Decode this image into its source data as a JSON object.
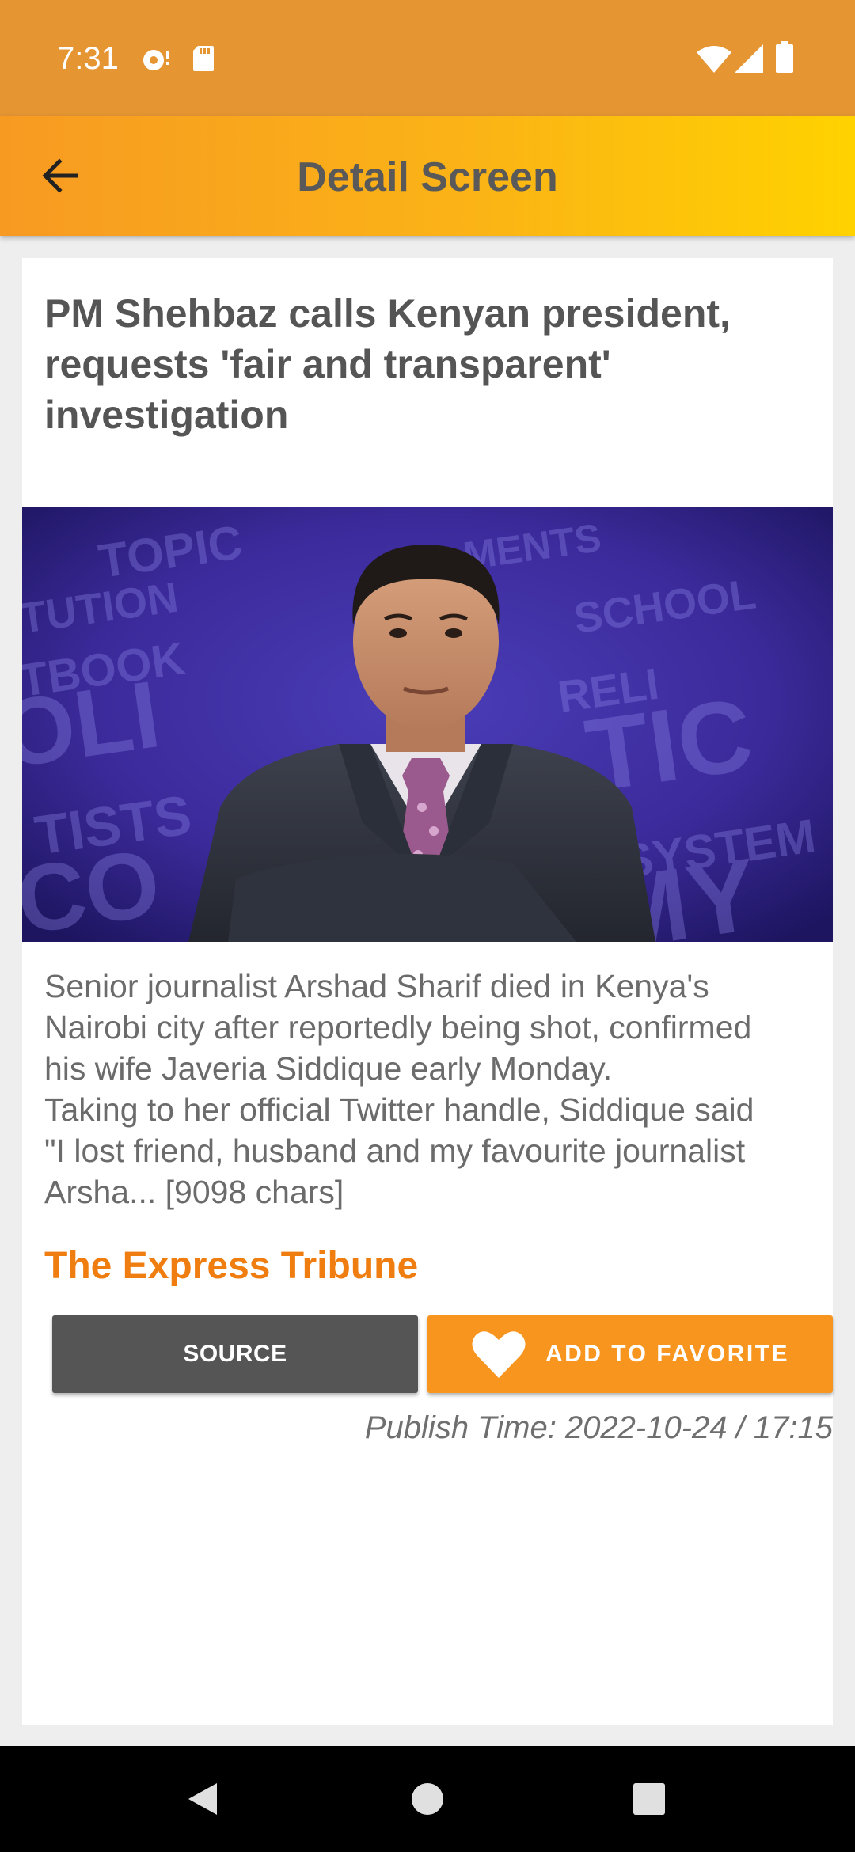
{
  "status_bar": {
    "time": "7:31",
    "icons": [
      "notification-icon",
      "sd-card-icon",
      "wifi-icon",
      "signal-icon",
      "battery-icon"
    ]
  },
  "toolbar": {
    "back_icon": "arrow-left-icon",
    "title": "Detail Screen"
  },
  "article": {
    "headline": "PM Shehbaz calls Kenyan president, requests 'fair and transparent' investigation",
    "description_lines": [
      "Senior journalist Arshad Sharif died in Kenya's",
      "Nairobi city after reportedly being shot, confirmed",
      "his wife Javeria Siddique early Monday.",
      "Taking to her official Twitter handle, Siddique said",
      "\"I lost friend, husband and my favourite journalist",
      "Arsha... [9098 chars]"
    ],
    "source_name": "The Express Tribune",
    "publish_time": "Publish Time: 2022-10-24 / 17:15"
  },
  "buttons": {
    "source_label": "SOURCE",
    "favorite_label": "ADD TO FAVORITE",
    "favorite_icon": "heart-icon"
  },
  "colors": {
    "status_bar": "#e59633",
    "toolbar_start": "#f79a22",
    "toolbar_end": "#ffd200",
    "source_name": "#ef7d0f",
    "source_button": "#555555",
    "favorite_button": "#f7951f"
  },
  "nav_bar": {
    "icons": [
      "back-triangle-icon",
      "home-circle-icon",
      "recents-square-icon"
    ]
  }
}
